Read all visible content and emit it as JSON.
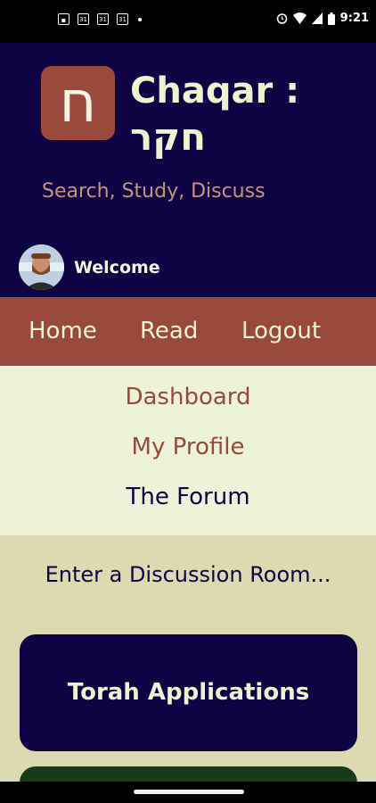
{
  "status_bar": {
    "time": "9:21",
    "notification_icons": [
      "app-notification-icon",
      "calendar-icon",
      "calendar-icon",
      "calendar-icon"
    ],
    "calendar_label": "31",
    "status_icons": [
      "alarm-icon",
      "wifi-icon",
      "signal-icon",
      "battery-icon"
    ]
  },
  "header": {
    "logo_letter": "ח",
    "title_line1": "Chaqar :",
    "title_line2": "חקר",
    "tagline": "Search, Study, Discuss",
    "welcome": "Welcome"
  },
  "nav": {
    "items": [
      {
        "label": "Home"
      },
      {
        "label": "Read"
      },
      {
        "label": "Logout"
      }
    ]
  },
  "submenu": {
    "items": [
      {
        "label": "Dashboard",
        "color": "#99493c"
      },
      {
        "label": "My Profile",
        "color": "#99493c"
      },
      {
        "label": "The Forum",
        "color": "#0e0444"
      }
    ]
  },
  "content": {
    "heading": "Enter a Discussion Room...",
    "rooms": [
      {
        "label": "Torah Applications"
      }
    ]
  },
  "colors": {
    "header_bg": "#0e0444",
    "nav_bg": "#99493c",
    "submenu_bg": "#ecf3d9",
    "content_bg": "#ddd9b0"
  }
}
